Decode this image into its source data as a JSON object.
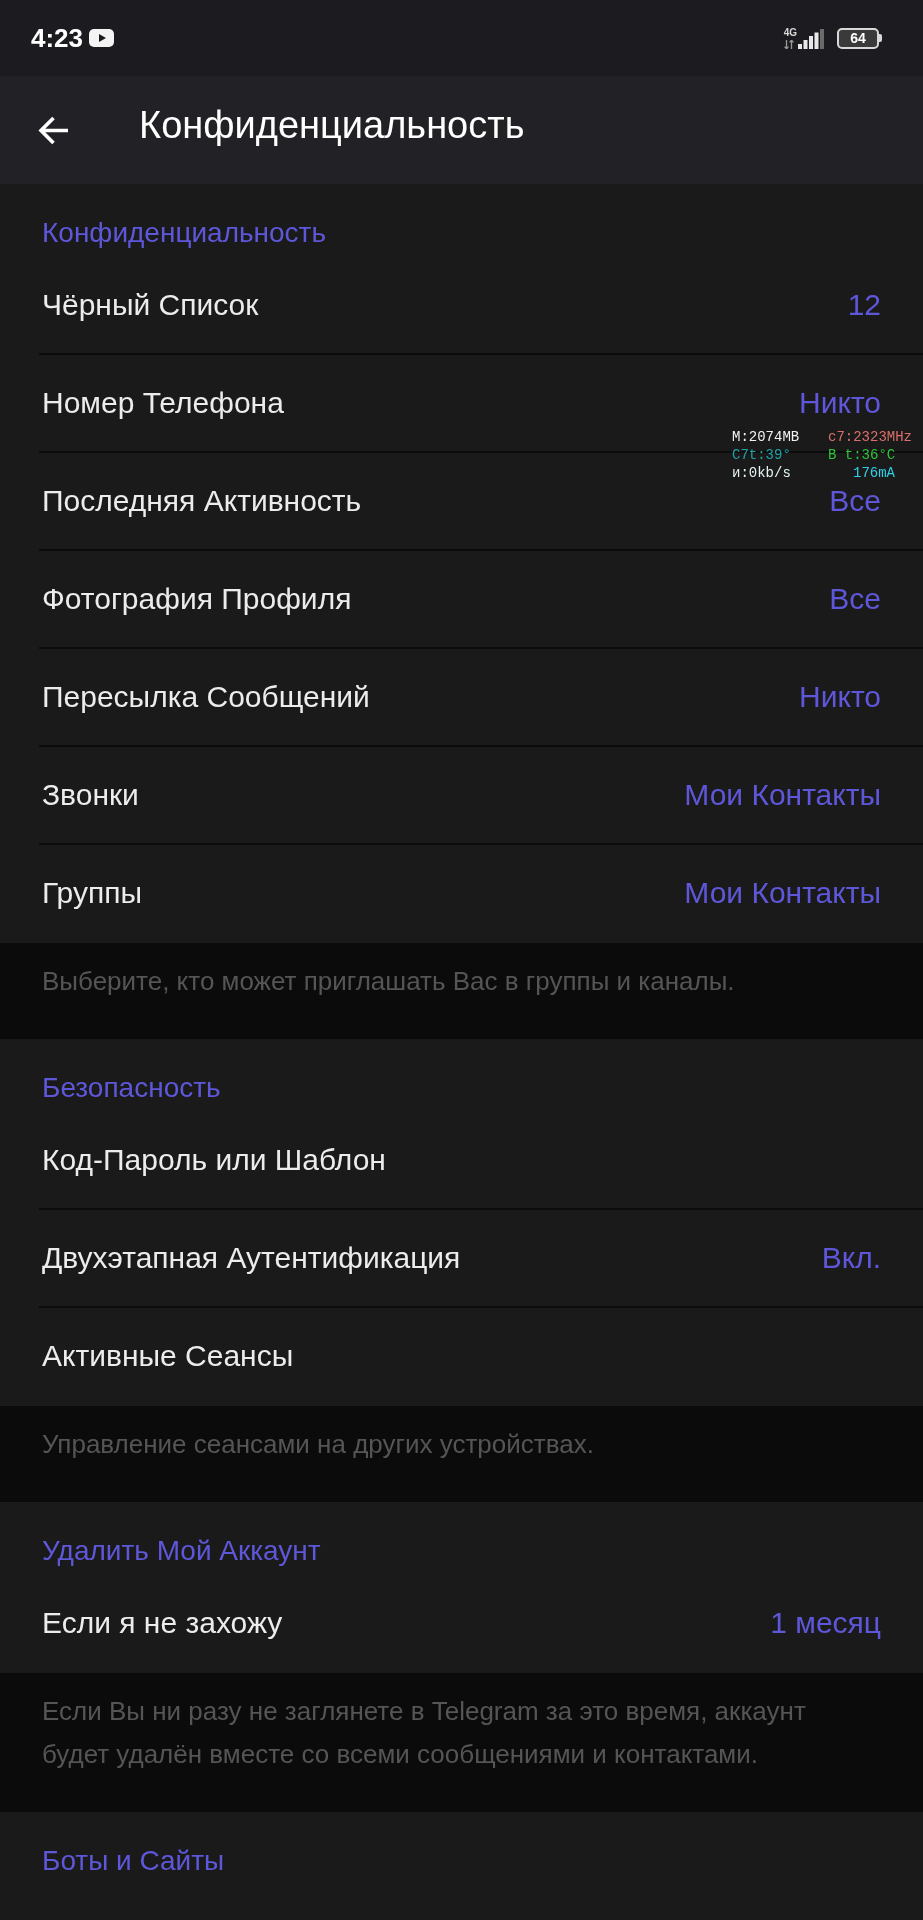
{
  "status_bar": {
    "time": "4:23",
    "network": "4G",
    "battery": "64"
  },
  "app_bar": {
    "title": "Конфиденциальность"
  },
  "sections": [
    {
      "header": "Конфиденциальность",
      "items": [
        {
          "label": "Чёрный Список",
          "value": "12"
        },
        {
          "label": "Номер Телефона",
          "value": "Никто"
        },
        {
          "label": "Последняя Активность",
          "value": "Все"
        },
        {
          "label": "Фотография Профиля",
          "value": "Все"
        },
        {
          "label": "Пересылка Сообщений",
          "value": "Никто"
        },
        {
          "label": "Звонки",
          "value": "Мои Контакты"
        },
        {
          "label": "Группы",
          "value": "Мои Контакты"
        }
      ],
      "footer": "Выберите, кто может приглашать Вас в группы и каналы."
    },
    {
      "header": "Безопасность",
      "items": [
        {
          "label": "Код-Пароль или Шаблон"
        },
        {
          "label": "Двухэтапная Аутентификация",
          "value": "Вкл."
        },
        {
          "label": "Активные Сеансы"
        }
      ],
      "footer": "Управление сеансами на других устройствах."
    },
    {
      "header": "Удалить Мой Аккаунт",
      "items": [
        {
          "label": "Если я не захожу",
          "value": "1 месяц"
        }
      ],
      "footer": "Если Вы ни разу не заглянете в Telegram за это время, аккаунт будет удалён вместе со всеми сообщениями и контактами."
    },
    {
      "header": "Боты и Сайты"
    }
  ],
  "performance_overlay": [
    {
      "text": "M:2074MB",
      "color": "#f2f2f2"
    },
    {
      "text": "c7:2323MHz",
      "color": "#d9706b"
    },
    {
      "text": "C7t:39°",
      "color": "#1fa3a8"
    },
    {
      "text": "B t:36°C",
      "color": "#2fc43a"
    },
    {
      "text": "и:0kb/s",
      "color": "#e4f4f4"
    },
    {
      "text": "176mA",
      "color": "#2fd0e8"
    }
  ]
}
